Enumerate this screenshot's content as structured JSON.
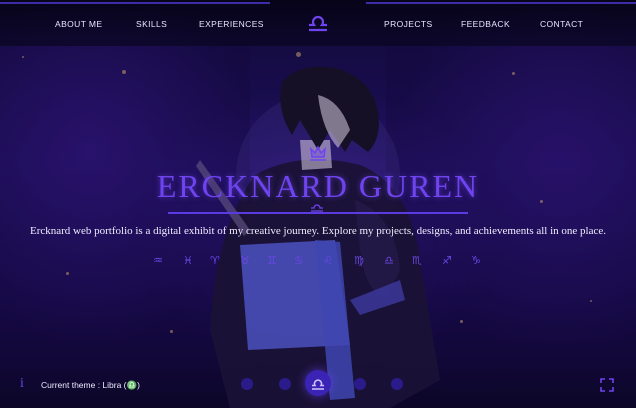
{
  "nav": {
    "items": [
      "ABOUT ME",
      "SKILLS",
      "EXPERIENCES",
      "PROJECTS",
      "FEEDBACK",
      "CONTACT"
    ],
    "logo_icon": "libra-icon"
  },
  "hero": {
    "crest_icon": "crown-crest-icon",
    "name": "ERCKNARD GUREN",
    "sub_icon": "libra-icon",
    "tagline": "Ercknard web portfolio is a digital exhibit of my creative journey. Explore my projects, designs, and achievements all in one place.",
    "zodiac_symbols": [
      "♒",
      "♓",
      "♈",
      "♉",
      "♊",
      "♋",
      "♌",
      "♍",
      "♎",
      "♏",
      "♐",
      "♑"
    ]
  },
  "footer": {
    "info_icon": "info-icon",
    "theme_label": "Current theme :  Libra (♎)",
    "theme_dots": 5,
    "active_theme_icon": "libra-icon",
    "fullscreen_icon": "fullscreen-icon"
  },
  "colors": {
    "accent": "#6f44f0",
    "text": "#f0eeff",
    "background": "#120a3a"
  }
}
